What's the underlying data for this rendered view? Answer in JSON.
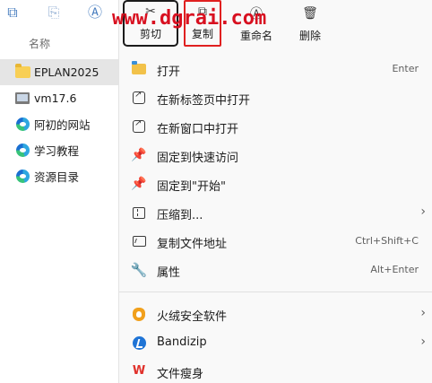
{
  "explorer": {
    "column_header": "名称",
    "nav_items": [
      {
        "label": "EPLAN2025",
        "icon": "folder-icon",
        "selected": true
      },
      {
        "label": "vm17.6",
        "icon": "vm-icon",
        "selected": false
      },
      {
        "label": "阿初的网站",
        "icon": "edge-icon",
        "selected": false
      },
      {
        "label": "学习教程",
        "icon": "edge-icon",
        "selected": false
      },
      {
        "label": "资源目录",
        "icon": "edge-icon",
        "selected": false
      }
    ]
  },
  "watermark": "www.dgrai.com",
  "quick_actions": [
    {
      "label": "剪切",
      "icon": "scissors-icon"
    },
    {
      "label": "复制",
      "icon": "copy-icon"
    },
    {
      "label": "重命名",
      "icon": "rename-icon"
    },
    {
      "label": "删除",
      "icon": "trash-icon"
    }
  ],
  "menu_items": [
    {
      "label": "打开",
      "shortcut": "Enter",
      "icon": "folder-open-icon",
      "submenu": false
    },
    {
      "label": "在新标签页中打开",
      "shortcut": "",
      "icon": "new-tab-icon",
      "submenu": false
    },
    {
      "label": "在新窗口中打开",
      "shortcut": "",
      "icon": "new-window-icon",
      "submenu": false
    },
    {
      "label": "固定到快速访问",
      "shortcut": "",
      "icon": "pin-icon",
      "submenu": false
    },
    {
      "label": "固定到\"开始\"",
      "shortcut": "",
      "icon": "pin-icon",
      "submenu": false
    },
    {
      "label": "压缩到...",
      "shortcut": "",
      "icon": "zip-icon",
      "submenu": true
    },
    {
      "label": "复制文件地址",
      "shortcut": "Ctrl+Shift+C",
      "icon": "copy-path-icon",
      "submenu": false
    },
    {
      "label": "属性",
      "shortcut": "Alt+Enter",
      "icon": "wrench-icon",
      "submenu": false
    }
  ],
  "extra_items": [
    {
      "label": "火绒安全软件",
      "icon": "huorong-icon",
      "submenu": true
    },
    {
      "label": "Bandizip",
      "icon": "bandizip-icon",
      "submenu": true
    },
    {
      "label": "文件瘦身",
      "icon": "wps-icon",
      "submenu": false
    }
  ],
  "colors": {
    "accent": "#2f6fd0",
    "highlight_border": "#e02020",
    "watermark": "#d81020",
    "folder": "#f8cf55"
  }
}
